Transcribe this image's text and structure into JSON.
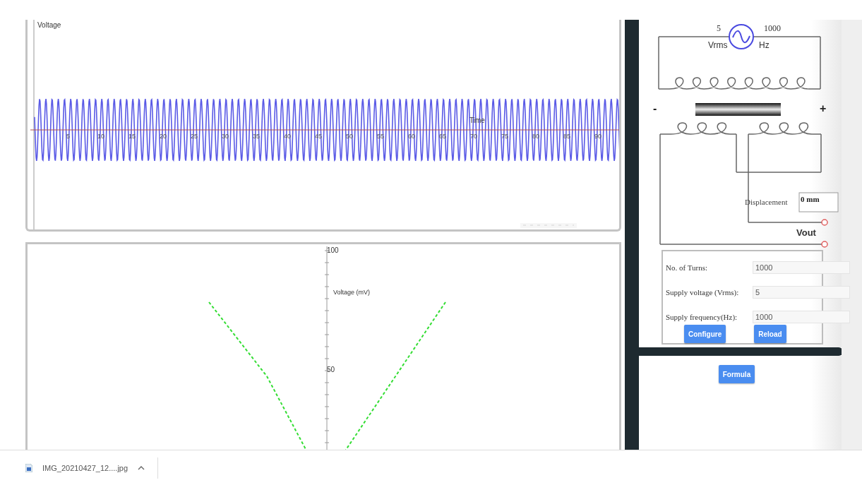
{
  "top_chart": {
    "ylabel": "Voltage",
    "xlabel": "Time",
    "xticks": [
      "5",
      "10",
      "15",
      "20",
      "25",
      "30",
      "35",
      "40",
      "45",
      "50",
      "55",
      "60",
      "65",
      "70",
      "75",
      "80",
      "85",
      "90"
    ]
  },
  "bottom_chart": {
    "ylabel": "Voltage (mV)",
    "yticks": [
      "100",
      "50"
    ]
  },
  "circuit": {
    "source_voltage": "5",
    "source_frequency": "1000",
    "voltage_unit": "Vrms",
    "frequency_unit": "Hz",
    "minus": "-",
    "plus": "+",
    "displacement_label": "Displacement",
    "displacement_value": "0 mm",
    "output_label": "Vout"
  },
  "form": {
    "fields": [
      {
        "label": "No. of Turns:",
        "value": "1000"
      },
      {
        "label": "Supply voltage (Vrms):",
        "value": "5"
      },
      {
        "label": "Supply frequency(Hz):",
        "value": "1000"
      }
    ],
    "buttons": [
      "Configure",
      "Reload"
    ]
  },
  "formula_button": "Formula",
  "download_bar": {
    "file": "IMG_20210427_12....jpg"
  }
}
